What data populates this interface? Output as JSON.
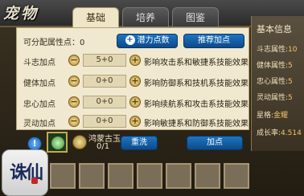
{
  "title": "宠物",
  "tabs": [
    {
      "label": "基础",
      "active": true
    },
    {
      "label": "培养",
      "active": false
    },
    {
      "label": "图鉴",
      "active": false
    }
  ],
  "allocate": {
    "free_points_label": "可分配属性点：",
    "free_points_value": "0",
    "potential_button": "潜力点数",
    "recommend_button": "推荐加点"
  },
  "stats": [
    {
      "name": "斗志加点",
      "value": "5+0",
      "effect": "影响攻击系和敏捷系技能效果"
    },
    {
      "name": "健体加点",
      "value": "0+0",
      "effect": "影响防御系和技机系技能效果"
    },
    {
      "name": "忠心加点",
      "value": "0+0",
      "effect": "影响续航系和攻击系技能效果"
    },
    {
      "name": "灵动加点",
      "value": "0+0",
      "effect": "影响敏捷系和防御系技能效果"
    }
  ],
  "item": {
    "name": "鸿蒙古玉",
    "count": "0/1",
    "reset_button": "重洗",
    "add_button": "加点"
  },
  "info": {
    "title": "基本信息",
    "lines": [
      {
        "label": "斗志属性:",
        "value": "10"
      },
      {
        "label": "健体属性:",
        "value": "5"
      },
      {
        "label": "忠心属性:",
        "value": "5"
      },
      {
        "label": "灵动属性:",
        "value": "5"
      },
      {
        "label": "星格:",
        "value": "金耀"
      },
      {
        "label": "成长率:",
        "value": "4.514"
      }
    ]
  },
  "logo_text": "诛仙",
  "colors": {
    "accent_blue": "#1d74c2",
    "panel": "#f0e8cf",
    "gold": "#f1c36a"
  }
}
